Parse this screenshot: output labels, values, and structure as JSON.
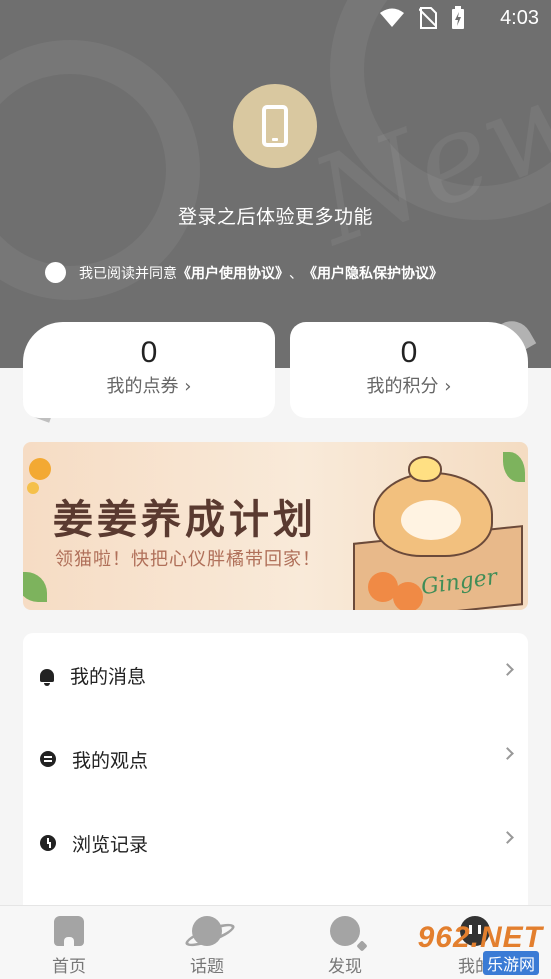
{
  "status_bar": {
    "time": "4:03"
  },
  "profile": {
    "login_prompt": "登录之后体验更多功能",
    "agreement_prefix": "我已阅读并同意",
    "user_agreement": "《用户使用协议》",
    "separator": "、",
    "privacy_agreement": "《用户隐私保护协议》"
  },
  "stats": [
    {
      "value": "0",
      "label": "我的点券 ›"
    },
    {
      "value": "0",
      "label": "我的积分 ›"
    }
  ],
  "banner": {
    "title": "姜姜养成计划",
    "subtitle": "领猫啦！快把心仪胖橘带回家！",
    "box_text": "Ginger"
  },
  "menu": [
    {
      "label": "我的消息",
      "icon": "bell-icon"
    },
    {
      "label": "我的观点",
      "icon": "comment-icon"
    },
    {
      "label": "浏览记录",
      "icon": "clock-icon"
    }
  ],
  "nav": [
    {
      "label": "首页",
      "icon": "home-icon"
    },
    {
      "label": "话题",
      "icon": "planet-icon"
    },
    {
      "label": "发现",
      "icon": "discover-icon"
    },
    {
      "label": "我的",
      "icon": "profile-icon"
    }
  ],
  "watermark": {
    "main": "962.NET",
    "sub": "乐游网"
  },
  "colors": {
    "header_bg": "#6f6f6f",
    "avatar_bg": "#d9c8a0",
    "page_bg": "#f5f5f5"
  }
}
